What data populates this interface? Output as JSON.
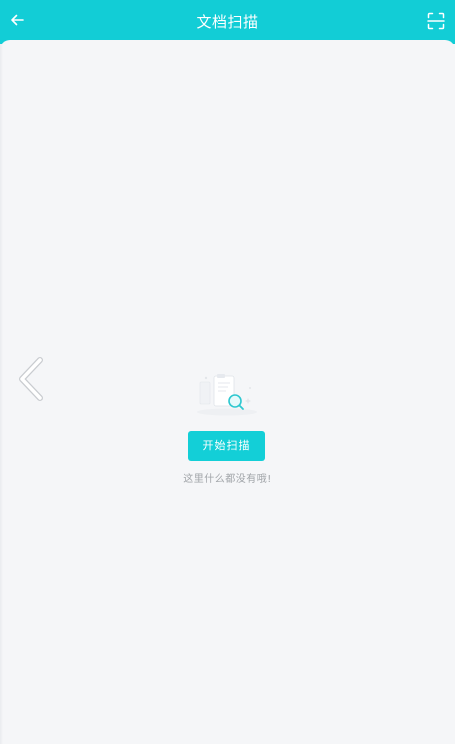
{
  "header": {
    "title": "文档扫描",
    "back_icon": "arrow-left-icon",
    "scan_icon": "scan-frame-icon",
    "color": "#12cdd6"
  },
  "side_nav": {
    "icon": "chevron-left-icon"
  },
  "empty_state": {
    "illustration_icon": "document-search-icon",
    "button_label": "开始扫描",
    "message": "这里什么都没有哦!",
    "button_color": "#13cfd7"
  }
}
